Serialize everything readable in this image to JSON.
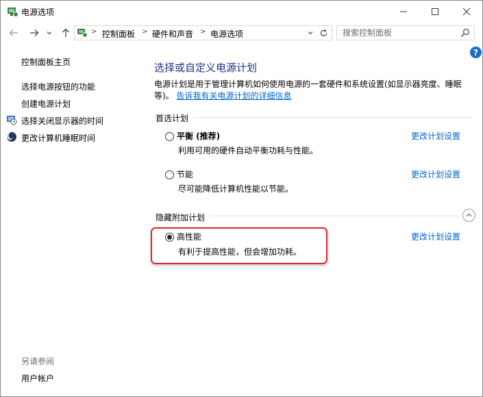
{
  "window": {
    "title": "电源选项"
  },
  "address": {
    "crumbs": [
      "控制面板",
      "硬件和声音",
      "电源选项"
    ],
    "search_placeholder": "搜索控制面板"
  },
  "sidebar": {
    "home": "控制面板主页",
    "links": [
      {
        "label": "选择电源按钮的功能",
        "icon": ""
      },
      {
        "label": "创建电源计划",
        "icon": ""
      },
      {
        "label": "选择关闭显示器的时间",
        "icon": "monitor-clock-icon"
      },
      {
        "label": "更改计算机睡眠时间",
        "icon": "moon-icon"
      }
    ],
    "see_also_header": "另请参阅",
    "see_also_links": [
      "用户帐户"
    ]
  },
  "main": {
    "title": "选择或自定义电源计划",
    "description": "电源计划是用于管理计算机如何使用电源的一套硬件和系统设置(如显示器亮度、睡眠等)。",
    "description_link": "告诉我有关电源计划的详细信息",
    "preferred_section": "首选计划",
    "hidden_section": "隐藏附加计划",
    "change_link": "更改计划设置",
    "plans": [
      {
        "name": "平衡 (推荐)",
        "desc": "利用可用的硬件自动平衡功耗与性能。",
        "selected": false
      },
      {
        "name": "节能",
        "desc": "尽可能降低计算机性能以节能。",
        "selected": false
      },
      {
        "name": "高性能",
        "desc": "有利于提高性能，但会增加功耗。",
        "selected": true
      }
    ]
  },
  "colors": {
    "title_blue": "#1e3287",
    "link_blue": "#0066cc",
    "highlight_red": "#e1262c"
  }
}
